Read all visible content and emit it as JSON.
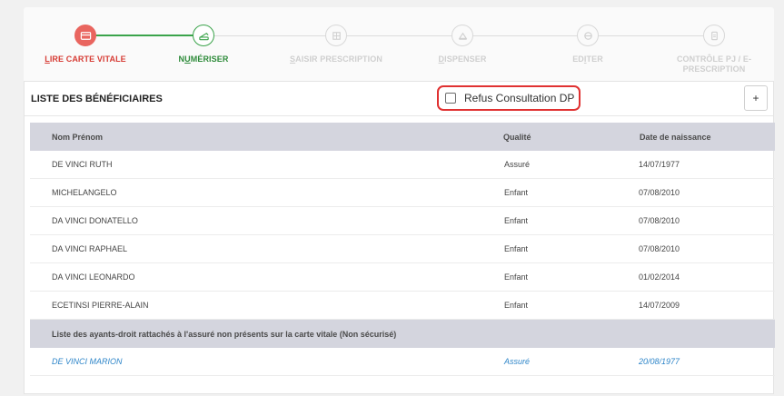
{
  "stepper": {
    "steps": [
      {
        "label": "Lire carte vitale",
        "first": "L",
        "rest": "ire carte vitale",
        "state": "error",
        "icon": "card-icon"
      },
      {
        "label": "Numériser",
        "first": "N",
        "rest": "UMÉRISER",
        "state": "active",
        "icon": "scanner-icon"
      },
      {
        "label": "Saisir prescription",
        "first": "S",
        "rest": "aisir prescription",
        "state": "inactive",
        "icon": "grid-icon"
      },
      {
        "label": "Dispenser",
        "first": "D",
        "rest": "ispenser",
        "state": "inactive",
        "icon": "pill-icon"
      },
      {
        "label": "Editer",
        "first": "",
        "rest": "Editer",
        "state": "inactive",
        "icon": "edit-icon"
      },
      {
        "label": "Contrôle PJ / E-Prescription",
        "first": "",
        "rest": "Contrôle PJ / E-Prescription",
        "state": "inactive",
        "icon": "document-icon"
      }
    ],
    "step_labels": {
      "s1_first": "L",
      "s1_rest": "IRE CARTE VITALE",
      "s2_first": "N",
      "s2_pre": "U",
      "s2_u": "M",
      "s2_rest": "ÉRISER",
      "s3_first": "S",
      "s3_rest": "AISIR PRESCRIPTION",
      "s4_first": "D",
      "s4_rest": "ISPENSER",
      "s5_pre": "ED",
      "s5_u": "I",
      "s5_rest": "TER",
      "s6_line1": "CONTRÔLE PJ / E-",
      "s6_line2": "PRESCRIPTION"
    },
    "colors": {
      "error": "#e9655f",
      "active": "#3aa34a",
      "inactive": "#d8d8d8"
    }
  },
  "panel": {
    "title": "LISTE DES BÉNÉFICIAIRES",
    "refus_label": "Refus Consultation DP",
    "refus_checked": false,
    "add_label": "+"
  },
  "table": {
    "headers": {
      "name": "Nom Prénom",
      "qualite": "Qualité",
      "dob": "Date de naissance"
    },
    "rows": [
      {
        "name": "DE VINCI RUTH",
        "qualite": "Assuré",
        "dob": "14/07/1977"
      },
      {
        "name": "MICHELANGELO",
        "qualite": "Enfant",
        "dob": "07/08/2010"
      },
      {
        "name": "DA VINCI DONATELLO",
        "qualite": "Enfant",
        "dob": "07/08/2010"
      },
      {
        "name": "DA VINCI RAPHAEL",
        "qualite": "Enfant",
        "dob": "07/08/2010"
      },
      {
        "name": "DA VINCI LEONARDO",
        "qualite": "Enfant",
        "dob": "01/02/2014"
      },
      {
        "name": "ECETINSI PIERRE-ALAIN",
        "qualite": "Enfant",
        "dob": "14/07/2009"
      }
    ],
    "subheader": "Liste des ayants-droit rattachés à l'assuré non présents sur la carte vitale (Non sécurisé)",
    "nonsecure_rows": [
      {
        "name": "DE VINCI MARION",
        "qualite": "Assuré",
        "dob": "20/08/1977"
      }
    ],
    "nonsecure_color": "#2f86c9"
  }
}
